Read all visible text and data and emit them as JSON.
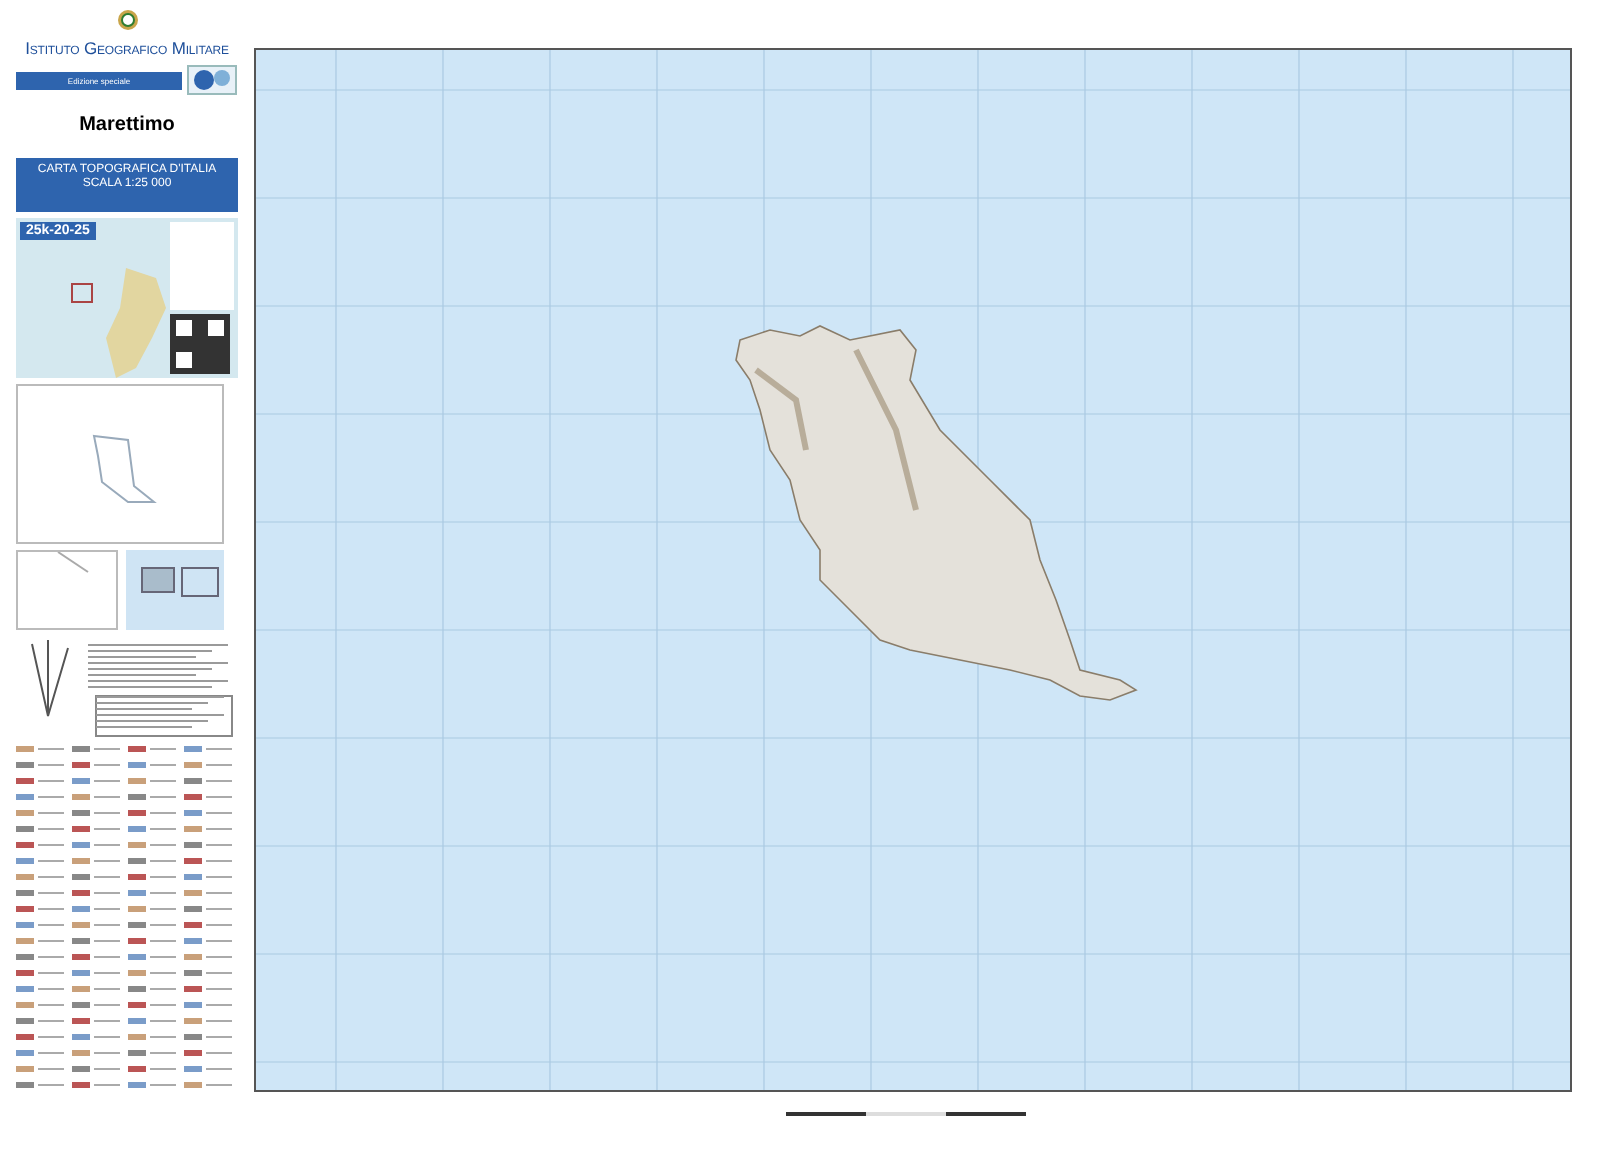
{
  "header": {
    "institute": "Istituto Geografico Militare",
    "edition": "Edizione speciale"
  },
  "sheet": {
    "title": "Marettimo",
    "series": "CARTA TOPOGRAFICA D'ITALIA",
    "scale": "SCALA 1:25 000",
    "code": "25k-20-25"
  }
}
